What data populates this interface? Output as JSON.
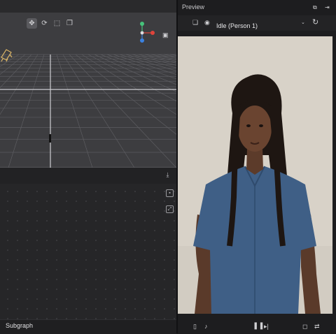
{
  "preview": {
    "title": "Preview",
    "animation_select": {
      "selected": "Idle (Person 1)"
    }
  },
  "node_editor": {
    "subgraph_label": "Subgraph"
  },
  "icons": {
    "viewport_toolbar": [
      "move-icon",
      "rotate-icon",
      "scale-icon",
      "copy-icon"
    ],
    "gizmo": "axis-gizmo-icon",
    "camera": "camera-icon",
    "preview_bottom": [
      "phone-icon",
      "tiktok-icon",
      "pause-icon",
      "next-frame-icon",
      "crop-icon",
      "swap-icon"
    ]
  },
  "colors": {
    "axis_x": "#e0443b",
    "axis_y": "#46c37b",
    "axis_z": "#3b82e0",
    "panel_bg": "#1d1d1f",
    "viewport_bg": "#3d3d40",
    "preview_bg": "#d6d0c6"
  }
}
